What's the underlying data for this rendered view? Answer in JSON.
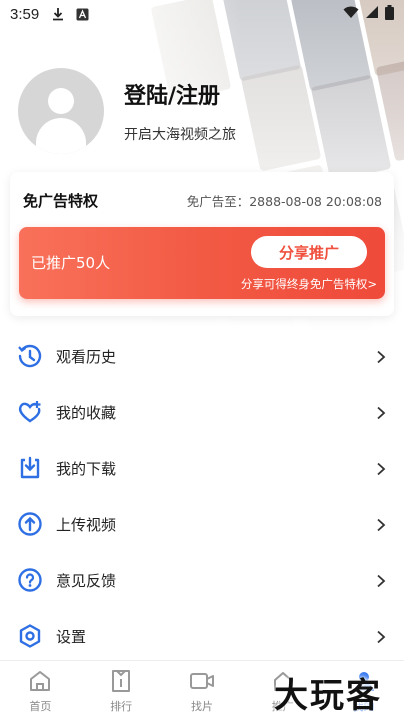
{
  "status_bar": {
    "time": "3:59",
    "icons": [
      "download-icon",
      "a-badge-icon",
      "wifi-icon",
      "signal-icon",
      "battery-icon"
    ]
  },
  "profile": {
    "title": "登陆/注册",
    "subtitle": "开启大海视频之旅"
  },
  "ad_card": {
    "title": "免广告特权",
    "expire": "免广告至：2888-08-08 20:08:08",
    "promo_count": "已推广50人",
    "share_button": "分享推广",
    "promo_note": "分享可得终身免广告特权>"
  },
  "menu": {
    "items": [
      {
        "label": "观看历史",
        "icon": "history-icon"
      },
      {
        "label": "我的收藏",
        "icon": "heart-plus-icon"
      },
      {
        "label": "我的下载",
        "icon": "download-box-icon"
      },
      {
        "label": "上传视频",
        "icon": "upload-icon"
      },
      {
        "label": "意见反馈",
        "icon": "question-icon"
      },
      {
        "label": "设置",
        "icon": "settings-icon"
      }
    ]
  },
  "bottom_nav": {
    "items": [
      {
        "label": "首页",
        "icon": "home-icon"
      },
      {
        "label": "排行",
        "icon": "ranking-icon"
      },
      {
        "label": "找片",
        "icon": "video-camera-icon"
      },
      {
        "label": "推广",
        "icon": "share-icon"
      },
      {
        "label": "我的",
        "icon": "user-icon"
      }
    ],
    "active": "我的"
  },
  "watermark": "大玩客",
  "colors": {
    "accent": "#3a7bf0",
    "promo_red": "#f0503e",
    "icon_blue": "#2f6fe4"
  }
}
